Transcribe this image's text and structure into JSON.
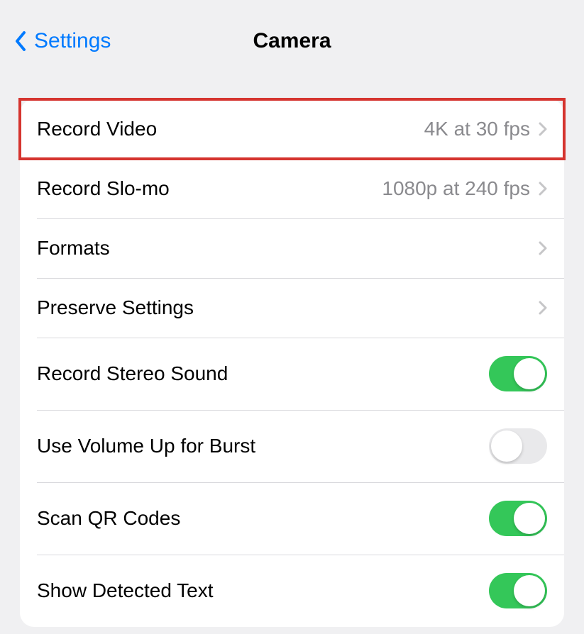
{
  "nav": {
    "back_label": "Settings",
    "title": "Camera"
  },
  "rows": {
    "record_video": {
      "label": "Record Video",
      "value": "4K at 30 fps"
    },
    "record_slomo": {
      "label": "Record Slo-mo",
      "value": "1080p at 240 fps"
    },
    "formats": {
      "label": "Formats"
    },
    "preserve": {
      "label": "Preserve Settings"
    },
    "stereo": {
      "label": "Record Stereo Sound",
      "on": true
    },
    "volume_burst": {
      "label": "Use Volume Up for Burst",
      "on": false
    },
    "scan_qr": {
      "label": "Scan QR Codes",
      "on": true
    },
    "detected_text": {
      "label": "Show Detected Text",
      "on": true
    }
  }
}
